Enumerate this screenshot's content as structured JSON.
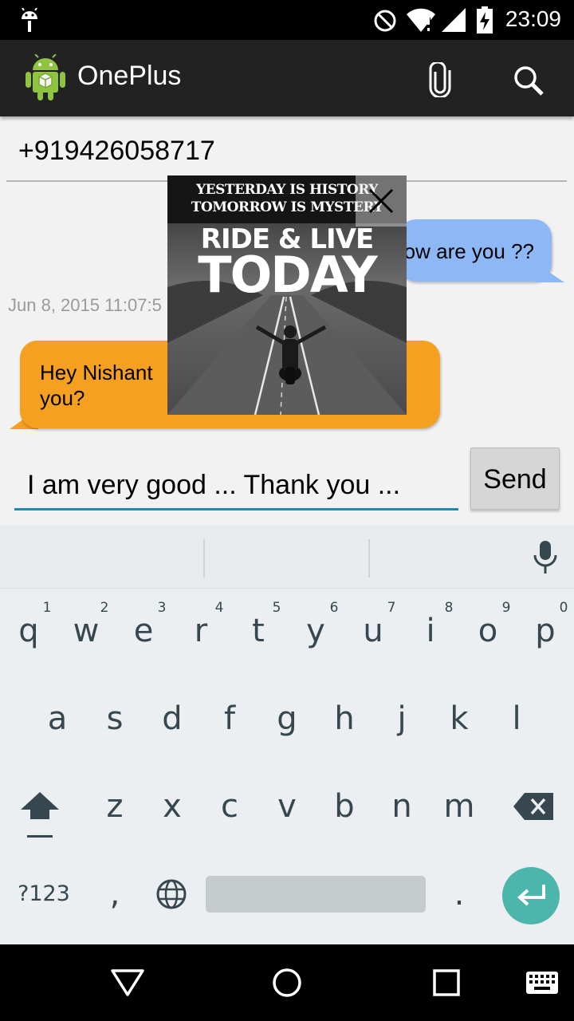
{
  "status_bar": {
    "time": "23:09",
    "icons": [
      "android-debug-icon",
      "do-not-disturb-icon",
      "wifi-icon",
      "cell-signal-icon",
      "battery-charging-icon"
    ]
  },
  "action_bar": {
    "title": "OnePlus",
    "icons": [
      "app-android-icon",
      "attach-icon",
      "search-icon"
    ]
  },
  "recipient": {
    "value": "+919426058717"
  },
  "messages": [
    {
      "direction": "sent",
      "text": "ow are you ??",
      "color": "#8db8f5"
    },
    {
      "direction": "received",
      "timestamp": "Jun 8, 2015 11:07:5",
      "text": "Hey Nishant",
      "text2": "you?",
      "color": "#f5a020"
    }
  ],
  "image_popup": {
    "line1": "YESTERDAY IS HISTORY",
    "line2": "TOMORROW IS MYSTERY",
    "line3": "RIDE & LIVE",
    "line4": "TODAY",
    "close_icon": "close-icon"
  },
  "compose": {
    "value": "I am very good ... Thank you ...",
    "send_label": "Send",
    "accent": "#1e88b5"
  },
  "keyboard": {
    "row1": [
      "q",
      "w",
      "e",
      "r",
      "t",
      "y",
      "u",
      "i",
      "o",
      "p"
    ],
    "row1_hints": [
      "1",
      "2",
      "3",
      "4",
      "5",
      "6",
      "7",
      "8",
      "9",
      "0"
    ],
    "row2": [
      "a",
      "s",
      "d",
      "f",
      "g",
      "h",
      "j",
      "k",
      "l"
    ],
    "row3": [
      "z",
      "x",
      "c",
      "v",
      "b",
      "n",
      "m"
    ],
    "symbols_label": "?123",
    "comma": ",",
    "period": ".",
    "enter_color": "#4db6ac",
    "icons": [
      "mic-icon",
      "shift-icon",
      "backspace-icon",
      "globe-icon",
      "enter-icon"
    ]
  },
  "nav_bar": {
    "icons": [
      "back-icon",
      "home-icon",
      "recents-icon",
      "keyboard-icon"
    ]
  }
}
